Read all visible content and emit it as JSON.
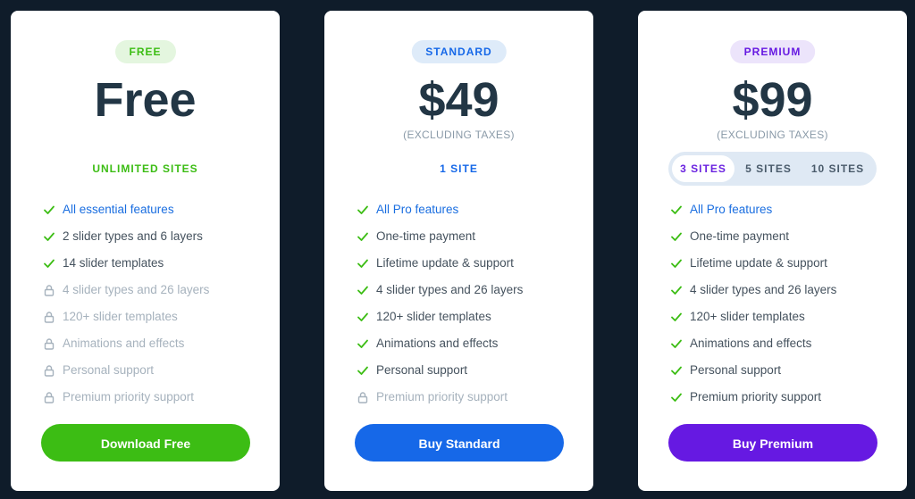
{
  "plans": [
    {
      "badge": "FREE",
      "price": "Free",
      "tax": "",
      "sites_label": "UNLIMITED SITES",
      "features": [
        {
          "text": "All essential features",
          "state": "highlight"
        },
        {
          "text": "2 slider types and 6 layers",
          "state": "included"
        },
        {
          "text": "14 slider templates",
          "state": "included"
        },
        {
          "text": "4 slider types and 26 layers",
          "state": "locked"
        },
        {
          "text": "120+ slider templates",
          "state": "locked"
        },
        {
          "text": "Animations and effects",
          "state": "locked"
        },
        {
          "text": "Personal support",
          "state": "locked"
        },
        {
          "text": "Premium priority support",
          "state": "locked"
        }
      ],
      "button_label": "Download Free"
    },
    {
      "badge": "STANDARD",
      "price": "$49",
      "tax": "(EXCLUDING TAXES)",
      "sites_label": "1 SITE",
      "features": [
        {
          "text": "All Pro features",
          "state": "highlight"
        },
        {
          "text": "One-time payment",
          "state": "included"
        },
        {
          "text": "Lifetime update & support",
          "state": "included"
        },
        {
          "text": "4 slider types and 26 layers",
          "state": "included"
        },
        {
          "text": "120+ slider templates",
          "state": "included"
        },
        {
          "text": "Animations and effects",
          "state": "included"
        },
        {
          "text": "Personal support",
          "state": "included"
        },
        {
          "text": "Premium priority support",
          "state": "locked"
        }
      ],
      "button_label": "Buy Standard"
    },
    {
      "badge": "PREMIUM",
      "price": "$99",
      "tax": "(EXCLUDING TAXES)",
      "sites_options": [
        "3 SITES",
        "5 SITES",
        "10 SITES"
      ],
      "sites_selected": "3 SITES",
      "features": [
        {
          "text": "All Pro features",
          "state": "highlight"
        },
        {
          "text": "One-time payment",
          "state": "included"
        },
        {
          "text": "Lifetime update & support",
          "state": "included"
        },
        {
          "text": "4 slider types and 26 layers",
          "state": "included"
        },
        {
          "text": "120+ slider templates",
          "state": "included"
        },
        {
          "text": "Animations and effects",
          "state": "included"
        },
        {
          "text": "Personal support",
          "state": "included"
        },
        {
          "text": "Premium priority support",
          "state": "included"
        }
      ],
      "button_label": "Buy Premium"
    }
  ],
  "icons": {
    "included": "check-icon",
    "highlight": "check-icon",
    "locked": "lock-icon"
  },
  "colors": {
    "free_accent": "#3cbd14",
    "free_badge_bg": "#e4f6df",
    "standard_accent": "#1668e8",
    "standard_badge_bg": "#deebf9",
    "premium_accent": "#6619e2",
    "premium_badge_bg": "#ece4fb",
    "check": "#3cbd14",
    "lock": "#a6b2bd"
  }
}
